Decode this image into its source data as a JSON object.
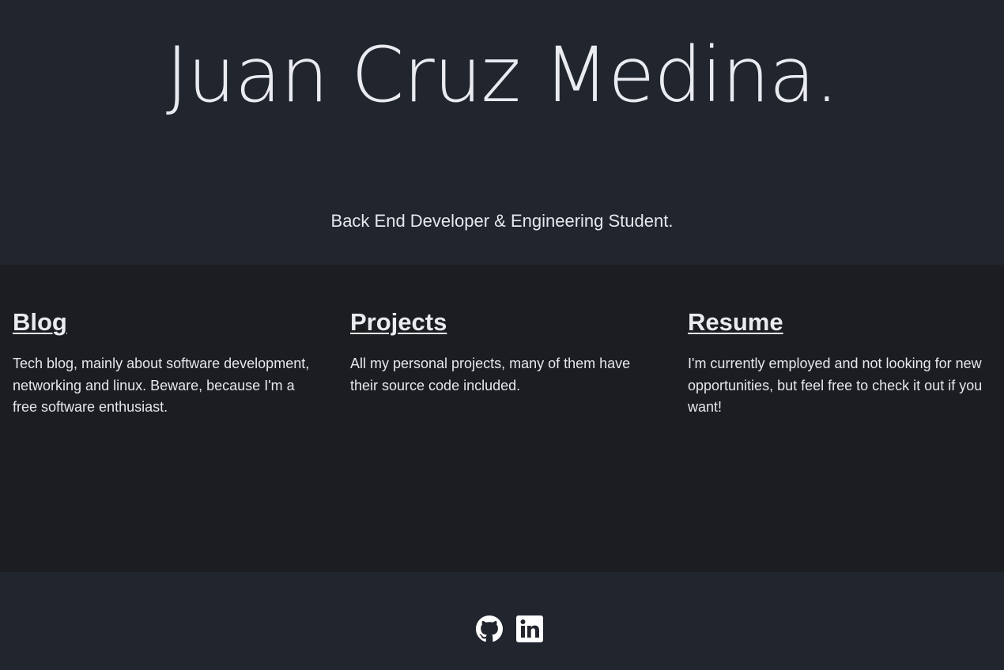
{
  "hero": {
    "title": "Juan Cruz Medina.",
    "subtitle": "Back End Developer & Engineering Student."
  },
  "sections": [
    {
      "heading": "Blog",
      "description": "Tech blog, mainly about software development, networking and linux. Beware, because I'm a free software enthusiast."
    },
    {
      "heading": "Projects",
      "description": "All my personal projects, many of them have their source code included."
    },
    {
      "heading": "Resume",
      "description": "I'm currently employed and not looking for new opportunities, but feel free to check it out if you want!"
    }
  ],
  "footer": {
    "icons": [
      "github-icon",
      "linkedin-icon"
    ]
  },
  "colors": {
    "hero_background": "#21252d",
    "sections_background": "#1c1d21",
    "text": "#e9ebf1"
  }
}
